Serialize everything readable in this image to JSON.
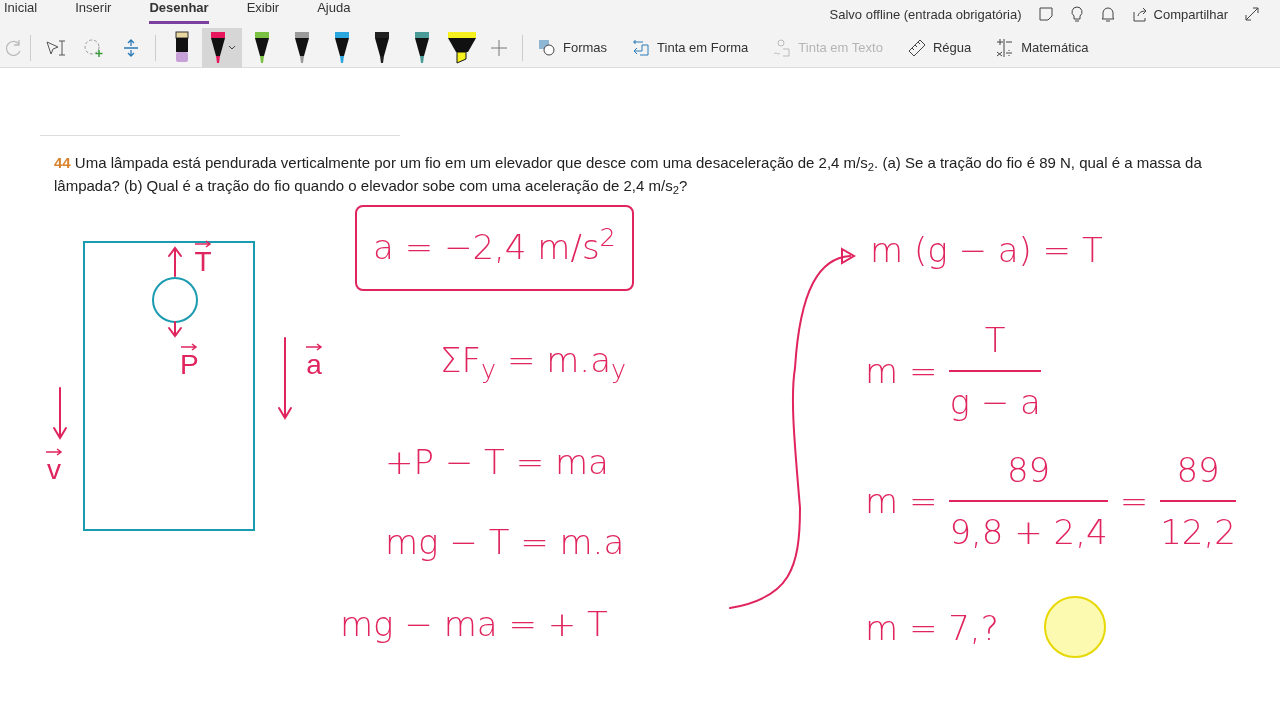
{
  "tabs": [
    {
      "label": "Inicial",
      "selected": false
    },
    {
      "label": "Inserir",
      "selected": false
    },
    {
      "label": "Desenhar",
      "selected": true
    },
    {
      "label": "Exibir",
      "selected": false
    },
    {
      "label": "Ajuda",
      "selected": false
    }
  ],
  "status": "Salvo offline (entrada obrigatória)",
  "share": "Compartilhar",
  "pens": [
    {
      "kind": "eraser",
      "color": "#c8a0d8",
      "selected": false
    },
    {
      "kind": "pen",
      "color": "#e8175d",
      "selected": true
    },
    {
      "kind": "pen",
      "color": "#7ac143",
      "selected": false
    },
    {
      "kind": "pen",
      "color": "#9a9a9a",
      "selected": false
    },
    {
      "kind": "pen",
      "color": "#2aa6de",
      "selected": false
    },
    {
      "kind": "pen",
      "color": "#222222",
      "selected": false
    },
    {
      "kind": "pen",
      "color": "#4a9a98",
      "selected": false
    },
    {
      "kind": "highlighter",
      "color": "#f6f01e",
      "selected": false
    }
  ],
  "tools": [
    {
      "kind": "shapes",
      "label": "Formas",
      "disabled": false
    },
    {
      "kind": "ink-shape",
      "label": "Tinta em Forma",
      "disabled": false
    },
    {
      "kind": "ink-text",
      "label": "Tinta em Texto",
      "disabled": true
    },
    {
      "kind": "ruler",
      "label": "Régua",
      "disabled": false
    },
    {
      "kind": "math",
      "label": "Matemática",
      "disabled": false
    }
  ],
  "question": {
    "number": "44",
    "text": "Uma lâmpada está pendurada verticalmente por um fio em um elevador que desce com uma desaceleração de 2,4 m/s$_{2}$. (a) Se a tração do fio é 89 N, qual é a massa da lâmpada? (b) Qual é a tração do fio quando o elevador sobe com uma aceleração de 2,4 m/s$_{2}$?"
  },
  "diagram": {
    "labels": [
      "T",
      "P",
      "a",
      "v"
    ]
  },
  "ink": [
    {
      "kind": "boxed",
      "parts": [
        {
          "kind": "text",
          "text": "a = −2,4 m/s$^{2}$"
        }
      ]
    },
    {
      "kind": "line",
      "parts": [
        {
          "kind": "text",
          "text": "ΣF$_{y}$ = m.a$_{y}$"
        }
      ]
    },
    {
      "kind": "line",
      "parts": [
        {
          "kind": "text",
          "text": "+P − T = ma"
        }
      ]
    },
    {
      "kind": "line",
      "parts": [
        {
          "kind": "text",
          "text": "mg − T = m.a"
        }
      ]
    },
    {
      "kind": "line",
      "parts": [
        {
          "kind": "text",
          "text": "mg − ma = + T"
        }
      ]
    },
    {
      "kind": "line",
      "parts": [
        {
          "kind": "text",
          "text": "m (g − a) = T"
        }
      ]
    },
    {
      "kind": "line",
      "parts": [
        {
          "kind": "text",
          "text": "m ="
        },
        {
          "kind": "fraction",
          "numerator": "T",
          "denominator": "g − a"
        }
      ]
    },
    {
      "kind": "line",
      "parts": [
        {
          "kind": "text",
          "text": "m ="
        },
        {
          "kind": "fraction",
          "numerator": "89",
          "denominator": "9,8 + 2,4"
        },
        {
          "kind": "text",
          "text": "="
        },
        {
          "kind": "fraction",
          "numerator": "89",
          "denominator": "12,2"
        }
      ]
    },
    {
      "kind": "line",
      "parts": [
        {
          "kind": "text",
          "text": "m = 7,?"
        }
      ]
    }
  ]
}
